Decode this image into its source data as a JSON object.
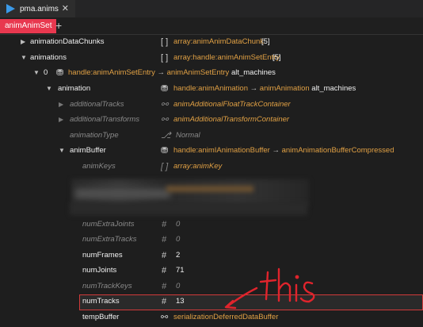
{
  "tab": {
    "title": "pma.anims",
    "close": "✕"
  },
  "subtab": {
    "label": "animAnimSet",
    "add": "+"
  },
  "rows": [
    {
      "name": "animationDataChunks",
      "icon": "[ ]",
      "value": "array:animAnimDataChunk",
      "suffix": "[5]"
    },
    {
      "name": "animations",
      "icon": "[ ]",
      "value": "array:handle:animAnimSetEntry",
      "suffix": "[5]"
    },
    {
      "index": "0",
      "value": "handle:animAnimSetEntry",
      "arrow": "→",
      "value2": "animAnimSetEntry",
      "suffix": "alt_machines"
    },
    {
      "name": "animation",
      "value": "handle:animAnimation",
      "arrow": "→",
      "value2": "animAnimation",
      "suffix": "alt_machines"
    },
    {
      "name": "additionalTracks",
      "value": "animAdditionalFloatTrackContainer"
    },
    {
      "name": "additionalTransforms",
      "value": "animAdditionalTransformContainer"
    },
    {
      "name": "animationType",
      "value": "Normal"
    },
    {
      "name": "animBuffer",
      "value": "handle:animIAnimationBuffer",
      "arrow": "→",
      "value2": "animAnimationBufferCompressed"
    },
    {
      "name": "animKeys",
      "icon": "[ ]",
      "value": "array:animKey"
    },
    {
      "name": "numExtraJoints",
      "icon": "#",
      "value": "0"
    },
    {
      "name": "numExtraTracks",
      "icon": "#",
      "value": "0"
    },
    {
      "name": "numFrames",
      "icon": "#",
      "value": "2"
    },
    {
      "name": "numJoints",
      "icon": "#",
      "value": "71"
    },
    {
      "name": "numTrackKeys",
      "icon": "#",
      "value": "0"
    },
    {
      "name": "numTracks",
      "icon": "#",
      "value": "13"
    },
    {
      "name": "tempBuffer",
      "value": "serializationDeferredDataBuffer"
    }
  ],
  "annotation": {
    "text": "this",
    "color": "#e0242c"
  }
}
